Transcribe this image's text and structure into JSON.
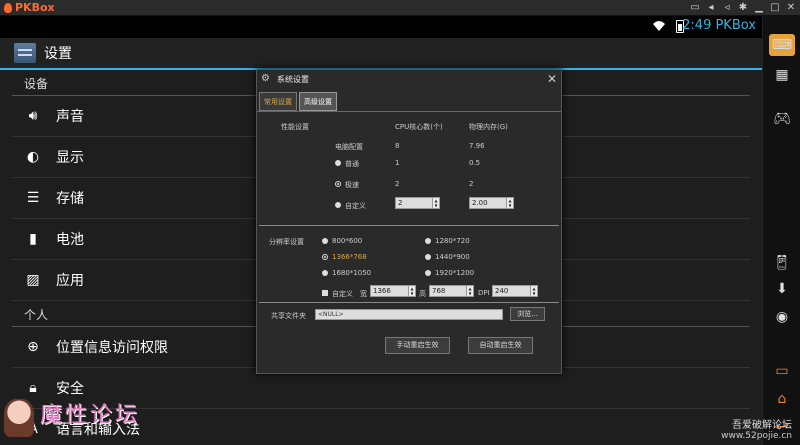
{
  "app": {
    "name": "PKBox"
  },
  "status": {
    "time": "2:49 PKBox"
  },
  "settings": {
    "title": "设置",
    "sections": [
      {
        "header": "设备"
      },
      {
        "header": "个人"
      }
    ],
    "items": {
      "sound": "声音",
      "display": "显示",
      "storage": "存储",
      "battery": "电池",
      "apps": "应用",
      "location": "位置信息访问权限",
      "security": "安全",
      "language": "语言和输入法"
    }
  },
  "dialog": {
    "title": "系统设置",
    "tabs": {
      "general": "常用设置",
      "advanced": "高级设置"
    },
    "perf": {
      "label": "性能设置",
      "col_cpu": "CPU核心数(个)",
      "col_mem": "物理内存(G)",
      "rows": [
        {
          "name": "电脑配置",
          "cpu": "8",
          "mem": "7.96"
        },
        {
          "name": "普通",
          "cpu": "1",
          "mem": "0.5"
        },
        {
          "name": "极速",
          "cpu": "2",
          "mem": "2"
        },
        {
          "name": "自定义",
          "cpu": "2",
          "mem": "2.00"
        }
      ]
    },
    "resolution": {
      "label": "分辨率设置",
      "options": [
        "800*600",
        "1280*720",
        "1366*768",
        "1440*900",
        "1680*1050",
        "1920*1200"
      ],
      "selected": "1366*768",
      "custom_label": "自定义",
      "width_label": "宽",
      "width": "1366",
      "height_label": "高",
      "height": "768",
      "dpi_label": "DPI",
      "dpi": "240"
    },
    "share": {
      "label": "共享文件夹",
      "value": "<NULL>",
      "browse": "浏览..."
    },
    "buttons": {
      "manual": "手动重启生效",
      "auto": "自动重启生效"
    }
  },
  "watermark": {
    "logo_text": "魔性论坛",
    "site_a": "吾爱破解论坛",
    "site_b": "www.52pojie.cn"
  }
}
